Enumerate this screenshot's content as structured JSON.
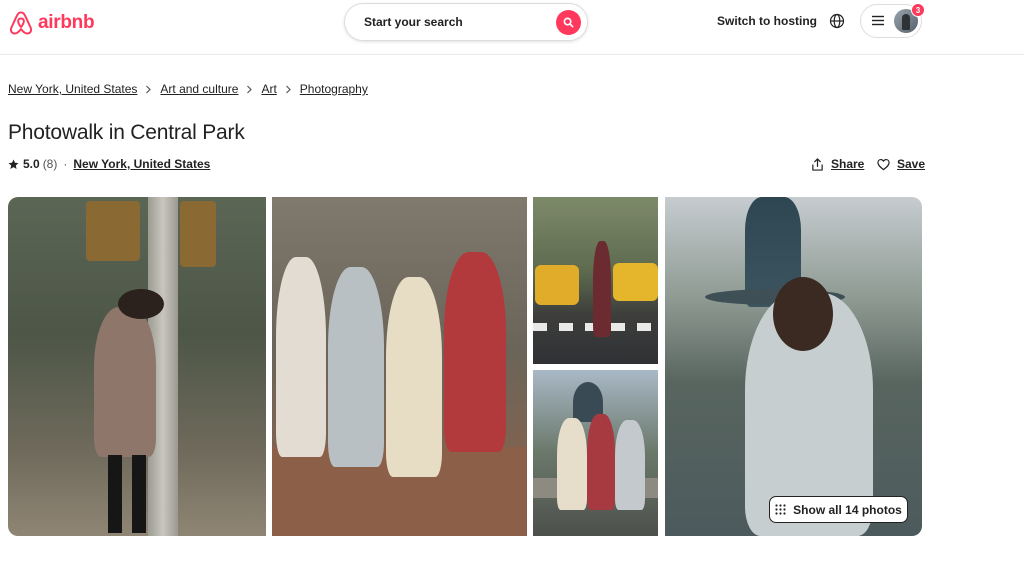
{
  "brand": {
    "name": "airbnb",
    "color": "#ff385c",
    "icon": "airbnb-logo-icon"
  },
  "header": {
    "search_label": "Start your search",
    "switch_hosting": "Switch to hosting",
    "globe_icon": "globe-icon",
    "menu_icon": "hamburger-menu-icon",
    "notification_count": "3"
  },
  "breadcrumb": {
    "items": [
      {
        "label": "New York, United States"
      },
      {
        "label": "Art and culture"
      },
      {
        "label": "Art"
      },
      {
        "label": "Photography"
      }
    ]
  },
  "listing": {
    "title": "Photowalk in Central Park",
    "rating": "5.0",
    "reviews": "(8)",
    "location": "New York, United States",
    "share_label": "Share",
    "save_label": "Save"
  },
  "gallery": {
    "show_all_label": "Show all 14 photos",
    "photos": [
      {
        "name": "photo-woman-lamppost"
      },
      {
        "name": "photo-four-women-walking"
      },
      {
        "name": "photo-woman-crosswalk-taxis"
      },
      {
        "name": "photo-three-women-fountain"
      },
      {
        "name": "photo-woman-trench-coat-fountain"
      }
    ]
  },
  "colors": {
    "text": "#222222",
    "border": "#dddddd",
    "accent": "#ff385c"
  }
}
